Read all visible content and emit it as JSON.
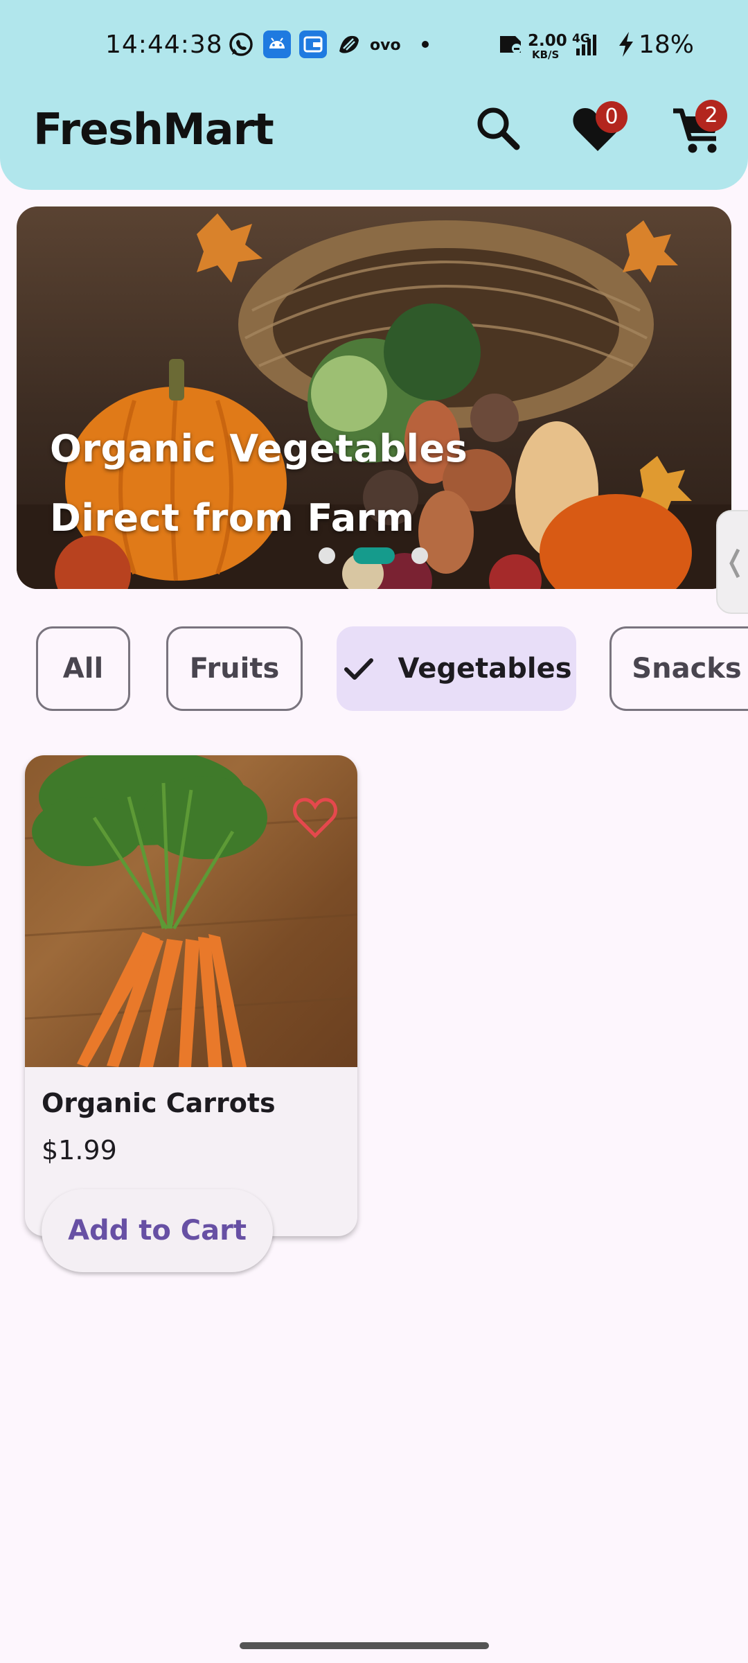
{
  "status_bar": {
    "time": "14:44:38",
    "net_speed_value": "2.00",
    "net_speed_unit": "KB/S",
    "network": "4G",
    "battery": "18%",
    "notification_icons": [
      "whatsapp-icon",
      "android-icon",
      "wallet-icon",
      "app-icon",
      "ovo-icon",
      "dot-icon"
    ]
  },
  "header": {
    "title": "FreshMart",
    "wishlist_count": "0",
    "cart_count": "2"
  },
  "banner": {
    "line1": "Organic Vegetables",
    "line2": "Direct from Farm",
    "active_slide": 2,
    "slide_count": 3
  },
  "categories": {
    "chips": [
      {
        "label": "All",
        "selected": false
      },
      {
        "label": "Fruits",
        "selected": false
      },
      {
        "label": "Vegetables",
        "selected": true
      },
      {
        "label": "Snacks",
        "selected": false
      }
    ]
  },
  "products": [
    {
      "name": "Organic Carrots",
      "price": "$1.99",
      "cta": "Add to Cart",
      "favorite": false
    }
  ],
  "colors": {
    "header_bg": "#b1e6ec",
    "page_bg": "#fdf6fd",
    "badge": "#b3261e",
    "chip_selected": "#e8def8",
    "primary": "#6750a4",
    "indicator_active": "#159b8c",
    "favorite": "#e5484d"
  }
}
